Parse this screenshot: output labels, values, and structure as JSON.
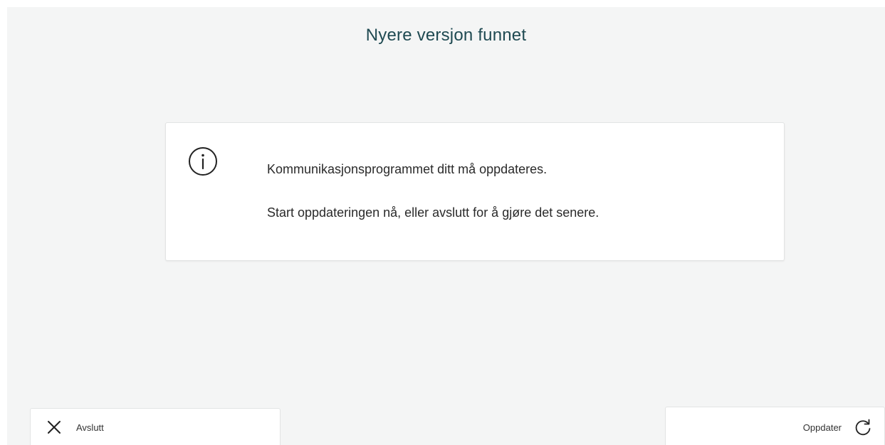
{
  "header": {
    "title": "Nyere versjon funnet"
  },
  "info_card": {
    "icon": "info-icon",
    "message_line_1": "Kommunikasjonsprogrammet ditt må oppdateres.",
    "message_line_2": "Start oppdateringen nå, eller avslutt for å gjøre det senere."
  },
  "footer": {
    "exit_button": {
      "label": "Avslutt",
      "icon": "close-icon"
    },
    "update_button": {
      "label": "Oppdater",
      "icon": "refresh-icon"
    }
  },
  "colors": {
    "title": "#1f4a52",
    "background": "#f4f5f5",
    "card": "#ffffff"
  }
}
